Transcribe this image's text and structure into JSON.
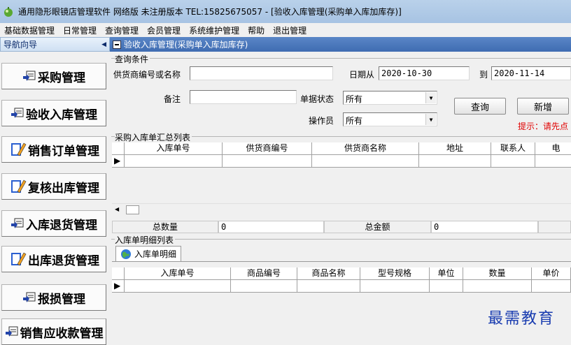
{
  "window": {
    "title": "通用隐形眼镜店管理软件 网络版  未注册版本  TEL:15825675057  - [验收入库管理(采购单入库加库存)]"
  },
  "menu": [
    "基础数据管理",
    "日常管理",
    "查询管理",
    "会员管理",
    "系统维护管理",
    "帮助",
    "退出管理"
  ],
  "nav": {
    "header": "导航向导",
    "items": [
      {
        "label": "采购管理",
        "icon": "document-icon"
      },
      {
        "label": "验收入库管理",
        "icon": "document-icon"
      },
      {
        "label": "销售订单管理",
        "icon": "edit-pencil-icon"
      },
      {
        "label": "复核出库管理",
        "icon": "edit-pencil-icon"
      },
      {
        "label": "入库退货管理",
        "icon": "document-icon"
      },
      {
        "label": "出库退货管理",
        "icon": "edit-pencil-icon"
      },
      {
        "label": "报损管理",
        "icon": "document-icon"
      },
      {
        "label": "销售应收款管理",
        "icon": "document-icon"
      }
    ]
  },
  "main": {
    "header": "验收入库管理(采购单入库加库存)",
    "query": {
      "group_title": "查询条件",
      "supplier_label": "供货商编号或名称",
      "supplier_value": "",
      "date_from_label": "日期从",
      "date_from": "2020-10-30",
      "date_to_label": "到",
      "date_to": "2020-11-14",
      "remark_label": "备注",
      "remark_value": "",
      "status_label": "单据状态",
      "status_value": "所有",
      "operator_label": "操作员",
      "operator_value": "所有",
      "search_button": "查询",
      "add_button": "新增",
      "hint": "提示：请先点"
    },
    "summary": {
      "group_title": "采购入库单汇总列表",
      "columns": [
        "入库单号",
        "供货商编号",
        "供货商名称",
        "地址",
        "联系人",
        "电"
      ],
      "total_count_label": "总数量",
      "total_count": "0",
      "total_amount_label": "总金额",
      "total_amount": "0"
    },
    "detail": {
      "group_title": "入库单明细列表",
      "tab_label": "入库单明细",
      "columns": [
        "入库单号",
        "商品编号",
        "商品名称",
        "型号规格",
        "单位",
        "数量",
        "单价"
      ]
    },
    "watermark": "最需教育"
  }
}
